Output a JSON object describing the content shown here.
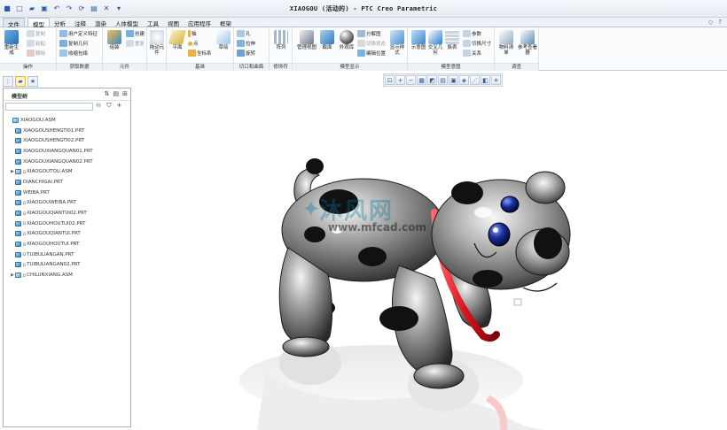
{
  "app": {
    "title": "XIAOGOU (活动的) - PTC Creo Parametric"
  },
  "menu_tabs": [
    "文件",
    "模型",
    "分析",
    "注释",
    "渲染",
    "人体模型",
    "工具",
    "视图",
    "应用程序",
    "框架"
  ],
  "ribbon": {
    "operations": {
      "regen": "重新生成",
      "copy": "复制",
      "paste": "粘贴",
      "delete": "删除",
      "label": "操作"
    },
    "get_data": {
      "udf": "用户定义特征",
      "copy_geom": "复制几何",
      "shrinkwrap": "收缩包络",
      "label": "获取数据"
    },
    "component": {
      "assemble": "组装",
      "create": "创建",
      "repeat": "重复",
      "label": "元件"
    },
    "drag": {
      "label": "拖动元件"
    },
    "datum": {
      "plane": "平面",
      "axis": "轴",
      "point": "点",
      "csys": "坐标系",
      "sketch": "草绘",
      "label": "基准"
    },
    "cut": {
      "hole": "孔",
      "extrude": "拉伸",
      "revolve": "旋转",
      "label": "切口和曲面"
    },
    "modifiers": {
      "pattern": "阵列",
      "label": "修饰符"
    },
    "display": {
      "manage_views": "管理视图",
      "section": "截面",
      "appearance": "外观库",
      "exploded": "分解图",
      "toggle_state": "切换状态",
      "edit_pos": "编辑位置",
      "style": "显示样式",
      "label": "模型显示"
    },
    "intent": {
      "display": "示意图",
      "cross": "交叉几何",
      "table": "族表",
      "params": "参数",
      "switch_dim": "切换尺寸",
      "relations": "关系",
      "label": "模型意图"
    },
    "investigate": {
      "bom": "物料清单",
      "ref_viewer": "参考查看器",
      "label": "调查"
    }
  },
  "model_tree": {
    "title": "模型树",
    "search_placeholder": "",
    "items": [
      {
        "name": "XIAOGOU.ASM",
        "type": "asm",
        "level": 0,
        "expander": ""
      },
      {
        "name": "XIAOGOUSHENGTI01.PRT",
        "type": "prt",
        "level": 1,
        "expander": ""
      },
      {
        "name": "XIAOGOUSHENGTI02.PRT",
        "type": "prt",
        "level": 1,
        "expander": ""
      },
      {
        "name": "XIAOGOUXIANGQUAN01.PRT",
        "type": "prt",
        "level": 1,
        "expander": ""
      },
      {
        "name": "XIAOGOUXIANGQUAN02.PRT",
        "type": "prt",
        "level": 1,
        "expander": ""
      },
      {
        "name": "XIAOGOUTOU.ASM",
        "type": "asm",
        "level": 1,
        "expander": "▶",
        "mark": "D"
      },
      {
        "name": "DIANCHIGAI.PRT",
        "type": "prt",
        "level": 1,
        "expander": ""
      },
      {
        "name": "WEIBA.PRT",
        "type": "prt",
        "level": 1,
        "expander": ""
      },
      {
        "name": "XIAOGOUWEIBA.PRT",
        "type": "prt",
        "level": 1,
        "expander": "",
        "mark": "D"
      },
      {
        "name": "XIAOGOUQIANTUI02.PRT",
        "type": "prt",
        "level": 1,
        "expander": "",
        "mark": "D"
      },
      {
        "name": "XIAOGOUHOUTUI02.PRT",
        "type": "prt",
        "level": 1,
        "expander": "",
        "mark": "D"
      },
      {
        "name": "XIAOGOUQIANTUI.PRT",
        "type": "prt",
        "level": 1,
        "expander": "",
        "mark": "D"
      },
      {
        "name": "XIAOGOUHOUTUI.PRT",
        "type": "prt",
        "level": 1,
        "expander": "",
        "mark": "D"
      },
      {
        "name": "TUIBULIANGAN.PRT",
        "type": "prt",
        "level": 1,
        "expander": "",
        "mark": "D"
      },
      {
        "name": "TUIBULIANGAN02.PRT",
        "type": "prt",
        "level": 1,
        "expander": "",
        "mark": "D"
      },
      {
        "name": "CHILUNXIANG.ASM",
        "type": "asm",
        "level": 1,
        "expander": "▶",
        "mark": "D"
      }
    ]
  },
  "watermark": {
    "main": "沐风网",
    "url": "www.mfcad.com"
  },
  "colors": {
    "accent": "#2a5aa8",
    "collar": "#d8141c",
    "eye": "#1b2f9a"
  }
}
